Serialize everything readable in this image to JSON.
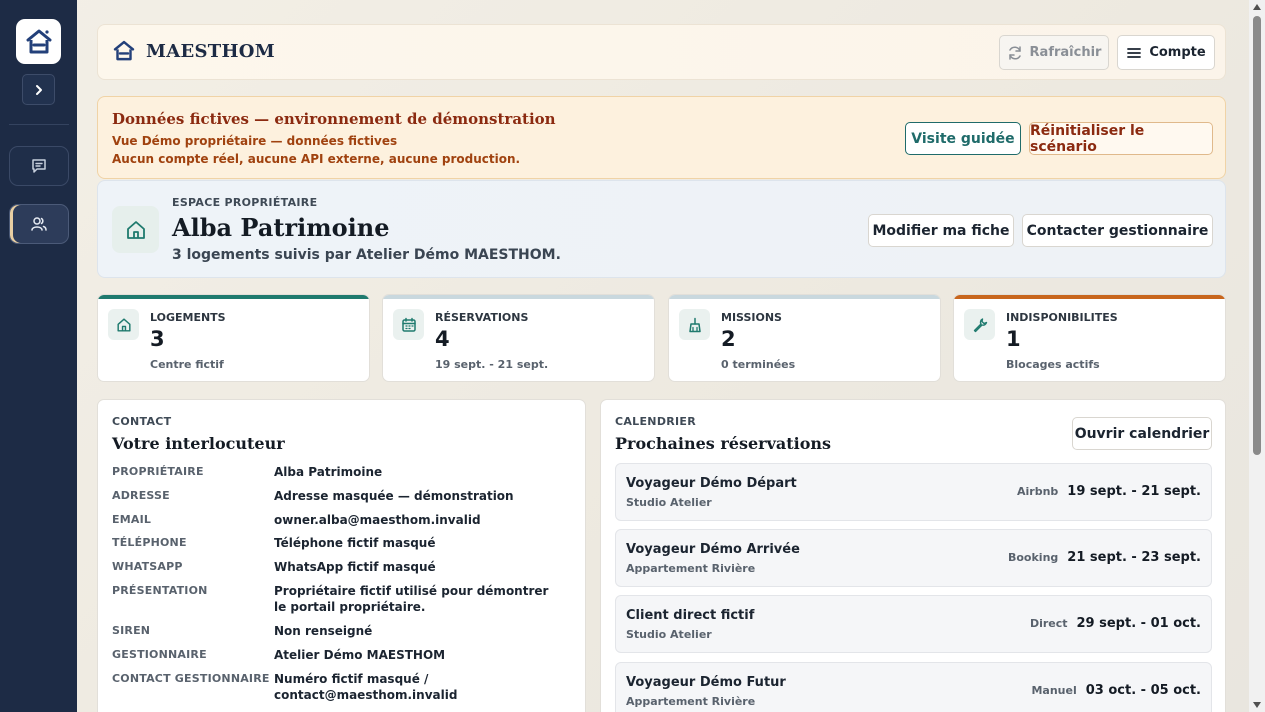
{
  "sidebar": {
    "logo_icon": "house-logo-icon",
    "expand_icon": "chevron-right-icon",
    "items": [
      {
        "icon": "message-icon"
      },
      {
        "icon": "users-icon"
      }
    ]
  },
  "topbar": {
    "brand": "MAESTHOM",
    "refresh_label": "Rafraîchir",
    "account_label": "Compte"
  },
  "banner": {
    "title": "Données fictives — environnement de démonstration",
    "line1": "Vue Démo propriétaire — données fictives",
    "line2": "Aucun compte réel, aucune API externe, aucune production.",
    "tour_label": "Visite guidée",
    "reset_label": "Réinitialiser le scénario"
  },
  "owner": {
    "eyebrow": "ESPACE PROPRIÉTAIRE",
    "name": "Alba Patrimoine",
    "subtitle": "3 logements suivis par Atelier Démo MAESTHOM.",
    "edit_label": "Modifier ma fiche",
    "contact_label": "Contacter gestionnaire"
  },
  "stats": [
    {
      "label": "LOGEMENTS",
      "value": "3",
      "sub": "Centre fictif",
      "icon": "home-icon",
      "color": "#1f7a6e"
    },
    {
      "label": "RÉSERVATIONS",
      "value": "4",
      "sub": "19 sept. - 21 sept.",
      "icon": "calendar-icon",
      "color": "#c9d8de"
    },
    {
      "label": "MISSIONS",
      "value": "2",
      "sub": "0 terminées",
      "icon": "broom-icon",
      "color": "#c9d8de"
    },
    {
      "label": "INDISPONIBILITES",
      "value": "1",
      "sub": "Blocages actifs",
      "icon": "wrench-icon",
      "color": "#c8661d"
    }
  ],
  "contact": {
    "eyebrow": "CONTACT",
    "title": "Votre interlocuteur",
    "rows": [
      {
        "k": "PROPRIÉTAIRE",
        "v": "Alba Patrimoine"
      },
      {
        "k": "ADRESSE",
        "v": "Adresse masquée — démonstration"
      },
      {
        "k": "EMAIL",
        "v": "owner.alba@maesthom.invalid"
      },
      {
        "k": "TÉLÉPHONE",
        "v": "Téléphone fictif masqué"
      },
      {
        "k": "WHATSAPP",
        "v": "WhatsApp fictif masqué"
      },
      {
        "k": "PRÉSENTATION",
        "v": "Propriétaire fictif utilisé pour démontrer le portail propriétaire."
      },
      {
        "k": "SIREN",
        "v": "Non renseigné"
      },
      {
        "k": "GESTIONNAIRE",
        "v": "Atelier Démo MAESTHOM"
      },
      {
        "k": "CONTACT GESTIONNAIRE",
        "v": "Numéro fictif masqué / contact@maesthom.invalid"
      }
    ]
  },
  "calendar": {
    "eyebrow": "CALENDRIER",
    "title": "Prochaines réservations",
    "open_label": "Ouvrir calendrier",
    "reservations": [
      {
        "guest": "Voyageur Démo Départ",
        "unit": "Studio Atelier",
        "channel": "Airbnb",
        "dates": "19 sept. - 21 sept."
      },
      {
        "guest": "Voyageur Démo Arrivée",
        "unit": "Appartement Rivière",
        "channel": "Booking",
        "dates": "21 sept. - 23 sept."
      },
      {
        "guest": "Client direct fictif",
        "unit": "Studio Atelier",
        "channel": "Direct",
        "dates": "29 sept. - 01 oct."
      },
      {
        "guest": "Voyageur Démo Futur",
        "unit": "Appartement Rivière",
        "channel": "Manuel",
        "dates": "03 oct. - 05 oct."
      }
    ]
  }
}
